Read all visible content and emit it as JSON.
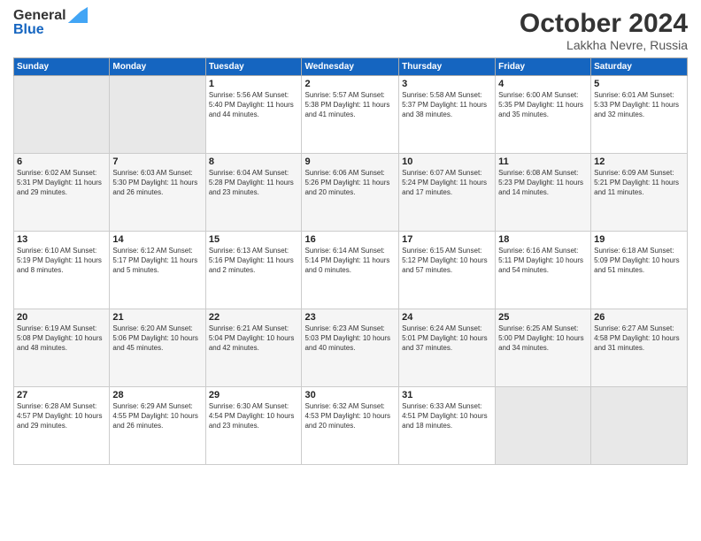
{
  "logo": {
    "general": "General",
    "blue": "Blue"
  },
  "title": "October 2024",
  "location": "Lakkha Nevre, Russia",
  "days_header": [
    "Sunday",
    "Monday",
    "Tuesday",
    "Wednesday",
    "Thursday",
    "Friday",
    "Saturday"
  ],
  "weeks": [
    [
      {
        "day": "",
        "info": ""
      },
      {
        "day": "",
        "info": ""
      },
      {
        "day": "1",
        "info": "Sunrise: 5:56 AM\nSunset: 5:40 PM\nDaylight: 11 hours and 44 minutes."
      },
      {
        "day": "2",
        "info": "Sunrise: 5:57 AM\nSunset: 5:38 PM\nDaylight: 11 hours and 41 minutes."
      },
      {
        "day": "3",
        "info": "Sunrise: 5:58 AM\nSunset: 5:37 PM\nDaylight: 11 hours and 38 minutes."
      },
      {
        "day": "4",
        "info": "Sunrise: 6:00 AM\nSunset: 5:35 PM\nDaylight: 11 hours and 35 minutes."
      },
      {
        "day": "5",
        "info": "Sunrise: 6:01 AM\nSunset: 5:33 PM\nDaylight: 11 hours and 32 minutes."
      }
    ],
    [
      {
        "day": "6",
        "info": "Sunrise: 6:02 AM\nSunset: 5:31 PM\nDaylight: 11 hours and 29 minutes."
      },
      {
        "day": "7",
        "info": "Sunrise: 6:03 AM\nSunset: 5:30 PM\nDaylight: 11 hours and 26 minutes."
      },
      {
        "day": "8",
        "info": "Sunrise: 6:04 AM\nSunset: 5:28 PM\nDaylight: 11 hours and 23 minutes."
      },
      {
        "day": "9",
        "info": "Sunrise: 6:06 AM\nSunset: 5:26 PM\nDaylight: 11 hours and 20 minutes."
      },
      {
        "day": "10",
        "info": "Sunrise: 6:07 AM\nSunset: 5:24 PM\nDaylight: 11 hours and 17 minutes."
      },
      {
        "day": "11",
        "info": "Sunrise: 6:08 AM\nSunset: 5:23 PM\nDaylight: 11 hours and 14 minutes."
      },
      {
        "day": "12",
        "info": "Sunrise: 6:09 AM\nSunset: 5:21 PM\nDaylight: 11 hours and 11 minutes."
      }
    ],
    [
      {
        "day": "13",
        "info": "Sunrise: 6:10 AM\nSunset: 5:19 PM\nDaylight: 11 hours and 8 minutes."
      },
      {
        "day": "14",
        "info": "Sunrise: 6:12 AM\nSunset: 5:17 PM\nDaylight: 11 hours and 5 minutes."
      },
      {
        "day": "15",
        "info": "Sunrise: 6:13 AM\nSunset: 5:16 PM\nDaylight: 11 hours and 2 minutes."
      },
      {
        "day": "16",
        "info": "Sunrise: 6:14 AM\nSunset: 5:14 PM\nDaylight: 11 hours and 0 minutes."
      },
      {
        "day": "17",
        "info": "Sunrise: 6:15 AM\nSunset: 5:12 PM\nDaylight: 10 hours and 57 minutes."
      },
      {
        "day": "18",
        "info": "Sunrise: 6:16 AM\nSunset: 5:11 PM\nDaylight: 10 hours and 54 minutes."
      },
      {
        "day": "19",
        "info": "Sunrise: 6:18 AM\nSunset: 5:09 PM\nDaylight: 10 hours and 51 minutes."
      }
    ],
    [
      {
        "day": "20",
        "info": "Sunrise: 6:19 AM\nSunset: 5:08 PM\nDaylight: 10 hours and 48 minutes."
      },
      {
        "day": "21",
        "info": "Sunrise: 6:20 AM\nSunset: 5:06 PM\nDaylight: 10 hours and 45 minutes."
      },
      {
        "day": "22",
        "info": "Sunrise: 6:21 AM\nSunset: 5:04 PM\nDaylight: 10 hours and 42 minutes."
      },
      {
        "day": "23",
        "info": "Sunrise: 6:23 AM\nSunset: 5:03 PM\nDaylight: 10 hours and 40 minutes."
      },
      {
        "day": "24",
        "info": "Sunrise: 6:24 AM\nSunset: 5:01 PM\nDaylight: 10 hours and 37 minutes."
      },
      {
        "day": "25",
        "info": "Sunrise: 6:25 AM\nSunset: 5:00 PM\nDaylight: 10 hours and 34 minutes."
      },
      {
        "day": "26",
        "info": "Sunrise: 6:27 AM\nSunset: 4:58 PM\nDaylight: 10 hours and 31 minutes."
      }
    ],
    [
      {
        "day": "27",
        "info": "Sunrise: 6:28 AM\nSunset: 4:57 PM\nDaylight: 10 hours and 29 minutes."
      },
      {
        "day": "28",
        "info": "Sunrise: 6:29 AM\nSunset: 4:55 PM\nDaylight: 10 hours and 26 minutes."
      },
      {
        "day": "29",
        "info": "Sunrise: 6:30 AM\nSunset: 4:54 PM\nDaylight: 10 hours and 23 minutes."
      },
      {
        "day": "30",
        "info": "Sunrise: 6:32 AM\nSunset: 4:53 PM\nDaylight: 10 hours and 20 minutes."
      },
      {
        "day": "31",
        "info": "Sunrise: 6:33 AM\nSunset: 4:51 PM\nDaylight: 10 hours and 18 minutes."
      },
      {
        "day": "",
        "info": ""
      },
      {
        "day": "",
        "info": ""
      }
    ]
  ]
}
